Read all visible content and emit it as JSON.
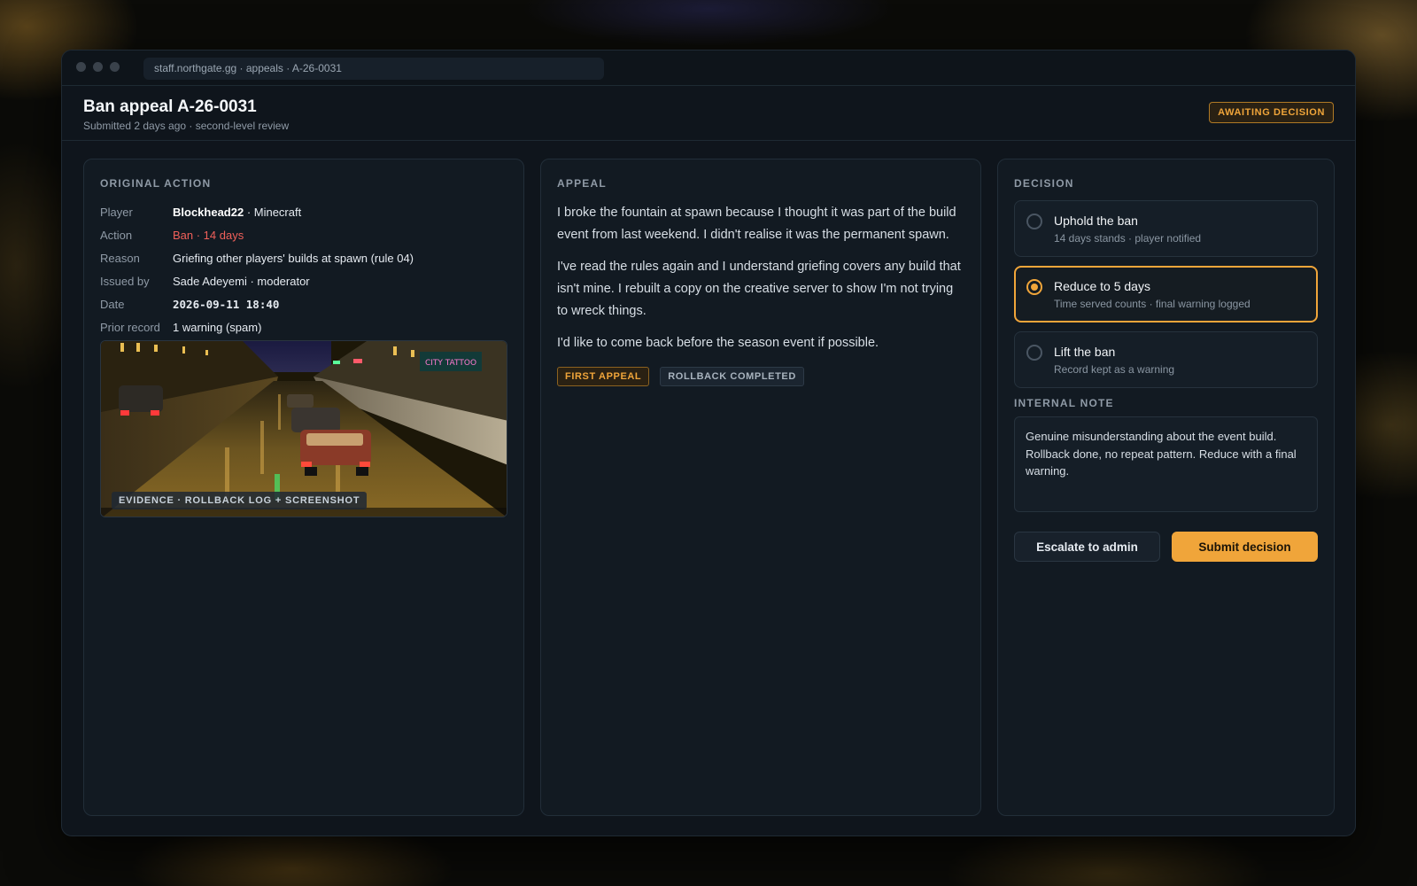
{
  "window": {
    "url": "staff.northgate.gg · appeals · A-26-0031"
  },
  "header": {
    "title": "Ban appeal A-26-0031",
    "subtitle": "Submitted 2 days ago · second-level review",
    "status": "AWAITING DECISION"
  },
  "original_action": {
    "label": "ORIGINAL ACTION",
    "rows": [
      {
        "key": "Player",
        "value_strong": "Blockhead22",
        "value": " · Minecraft"
      },
      {
        "key": "Action",
        "value": "Ban · 14 days"
      },
      {
        "key": "Reason",
        "value": "Griefing other players' builds at spawn (rule 04)"
      },
      {
        "key": "Issued by",
        "value": "Sade Adeyemi · moderator"
      },
      {
        "key": "Date",
        "value": "2026-09-11 18:40"
      },
      {
        "key": "Prior record",
        "value": "1 warning (spam)"
      }
    ],
    "evidence_caption": "EVIDENCE · ROLLBACK LOG + SCREENSHOT",
    "evidence_sign": "CITY TATTOO"
  },
  "appeal": {
    "label": "APPEAL",
    "paragraphs": [
      "I broke the fountain at spawn because I thought it was part of the build event from last weekend. I didn't realise it was the permanent spawn.",
      "I've read the rules again and I understand griefing covers any build that isn't mine. I rebuilt a copy on the creative server to show I'm not trying to wreck things.",
      "I'd like to come back before the season event if possible."
    ],
    "tags": [
      "FIRST APPEAL",
      "ROLLBACK COMPLETED"
    ]
  },
  "decision": {
    "label": "DECISION",
    "options": [
      {
        "title": "Uphold the ban",
        "sub": "14 days stands · player notified",
        "selected": false
      },
      {
        "title": "Reduce to 5 days",
        "sub": "Time served counts · final warning logged",
        "selected": true
      },
      {
        "title": "Lift the ban",
        "sub": "Record kept as a warning",
        "selected": false
      }
    ],
    "note_label": "INTERNAL NOTE",
    "note": "Genuine misunderstanding about the event build. Rollback done, no repeat pattern. Reduce with a final warning.",
    "escalate_label": "Escalate to admin",
    "submit_label": "Submit decision"
  },
  "colors": {
    "accent": "#f0a53a",
    "danger": "#f0605a",
    "panel": "#121a22"
  }
}
